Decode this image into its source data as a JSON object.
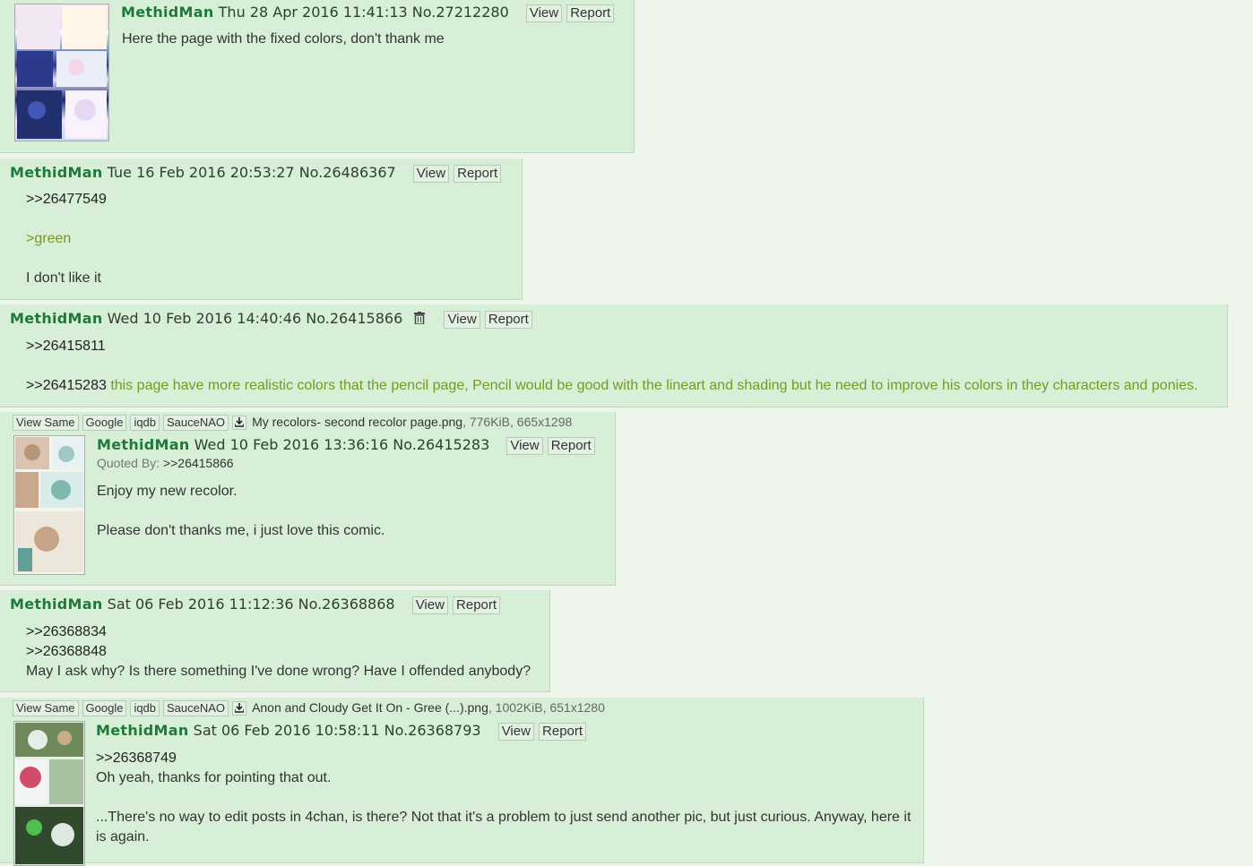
{
  "posts": [
    {
      "name": "MethidMan",
      "date": "Thu 28 Apr 2016 11:41:13",
      "number": "No.27212280",
      "view": "View",
      "report": "Report",
      "lines": [
        "Here the page with the fixed colors, don't thank me"
      ]
    },
    {
      "name": "MethidMan",
      "date": "Tue 16 Feb 2016 20:53:27",
      "number": "No.26486367",
      "view": "View",
      "report": "Report",
      "quote": ">>26477549",
      "greentext": ">green",
      "text": "I don't like it"
    },
    {
      "name": "MethidMan",
      "date": "Wed 10 Feb 2016 14:40:46",
      "number": "No.26415866",
      "view": "View",
      "report": "Report",
      "quote1": ">>26415811",
      "quote2": ">>26415283",
      "text": " this page have more realistic colors that the pencil page, Pencil would be good with the lineart and shading but he need to improve his colors in they characters and ponies."
    },
    {
      "file_buttons": [
        "View Same",
        "Google",
        "iqdb",
        "SauceNAO"
      ],
      "filename": "My recolors- second recolor page.png",
      "filemeta": ", 776KiB, 665x1298",
      "name": "MethidMan",
      "date": "Wed 10 Feb 2016 13:36:16",
      "number": "No.26415283",
      "view": "View",
      "report": "Report",
      "quoted_by_label": "Quoted By:",
      "quoted_by": ">>26415866",
      "line1": "Enjoy my new recolor.",
      "line2": "Please don't thanks me, i just love this comic."
    },
    {
      "name": "MethidMan",
      "date": "Sat 06 Feb 2016 11:12:36",
      "number": "No.26368868",
      "view": "View",
      "report": "Report",
      "quote1": ">>26368834",
      "quote2": ">>26368848",
      "text": "May I ask why? Is there something I've done wrong? Have I offended anybody?"
    },
    {
      "file_buttons": [
        "View Same",
        "Google",
        "iqdb",
        "SauceNAO"
      ],
      "filename": "Anon and Cloudy Get It On - Gree (...).png",
      "filemeta": ", 1002KiB, 651x1280",
      "name": "MethidMan",
      "date": "Sat 06 Feb 2016 10:58:11",
      "number": "No.26368793",
      "view": "View",
      "report": "Report",
      "quote": ">>26368749",
      "line1": "Oh yeah, thanks for pointing that out.",
      "line2": "...There's no way to edit posts in 4chan, is there? Not that it's a problem to just send another pic, but just curious. Anyway, here it is again."
    }
  ],
  "colors": {
    "background": "#eef6ec",
    "post": "#d6efd6",
    "name": "#1f7a3a",
    "greentext": "#789922"
  },
  "icons": [
    "trash-icon",
    "download-icon"
  ]
}
